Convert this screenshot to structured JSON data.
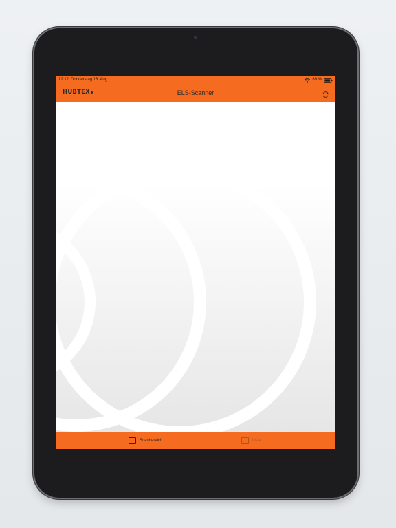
{
  "status_bar": {
    "time": "12:12",
    "date": "Donnerstag 18. Aug.",
    "battery": "89 %",
    "battery_level": 0.89
  },
  "nav_bar": {
    "logo": "HUBTEX",
    "title": "ELS-Scanner",
    "refresh_icon": "refresh-icon"
  },
  "tab_bar": {
    "tabs": [
      {
        "label": "Scanbereich",
        "icon": "scan-area-icon",
        "active": true
      },
      {
        "label": "Liste",
        "icon": "list-icon",
        "active": false
      }
    ]
  },
  "colors": {
    "brand_orange": "#f56b1f",
    "device_bezel": "#1c1c1e"
  }
}
